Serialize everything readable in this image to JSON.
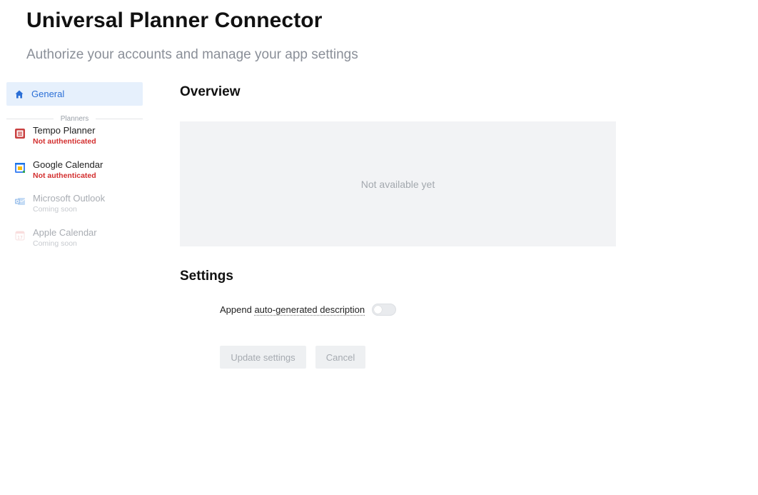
{
  "header": {
    "title": "Universal Planner Connector",
    "subtitle": "Authorize your accounts and manage your app settings"
  },
  "sidebar": {
    "general": {
      "label": "General",
      "icon": "home-icon"
    },
    "group_label": "Planners",
    "planners": [
      {
        "name": "Tempo Planner",
        "status": "Not authenticated",
        "icon": "tempo-planner-icon",
        "enabled": true
      },
      {
        "name": "Google Calendar",
        "status": "Not authenticated",
        "icon": "google-calendar-icon",
        "enabled": true
      },
      {
        "name": "Microsoft Outlook",
        "status": "Coming soon",
        "icon": "outlook-icon",
        "enabled": false
      },
      {
        "name": "Apple Calendar",
        "status": "Coming soon",
        "icon": "apple-calendar-icon",
        "enabled": false
      }
    ]
  },
  "overview": {
    "title": "Overview",
    "placeholder": "Not available yet"
  },
  "settings": {
    "title": "Settings",
    "append_label_prefix": "Append ",
    "append_label_link": "auto-generated description",
    "append_enabled": false,
    "update_button": "Update settings",
    "cancel_button": "Cancel"
  },
  "colors": {
    "accent": "#2b6fd6",
    "active_bg": "#e6f0fc",
    "error": "#d32f2f",
    "panel_bg": "#f2f3f5"
  }
}
